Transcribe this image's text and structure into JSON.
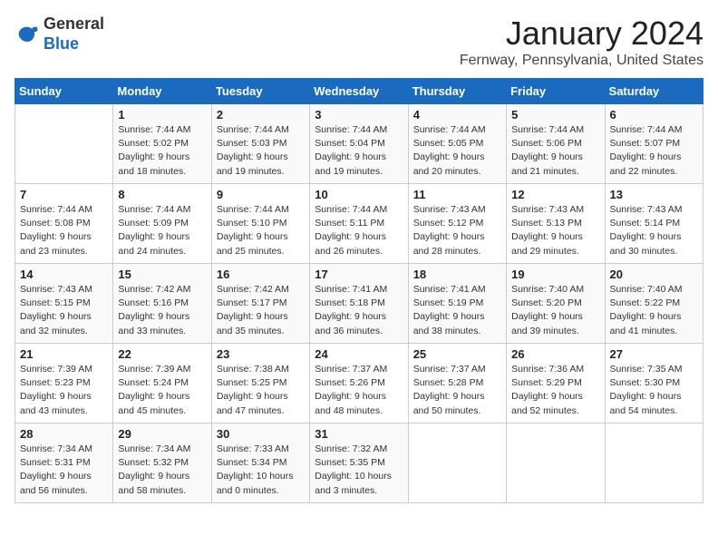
{
  "header": {
    "logo": {
      "general": "General",
      "blue": "Blue"
    },
    "title": "January 2024",
    "subtitle": "Fernway, Pennsylvania, United States"
  },
  "weekdays": [
    "Sunday",
    "Monday",
    "Tuesday",
    "Wednesday",
    "Thursday",
    "Friday",
    "Saturday"
  ],
  "weeks": [
    [
      {
        "day": "",
        "sunrise": "",
        "sunset": "",
        "daylight": ""
      },
      {
        "day": "1",
        "sunrise": "Sunrise: 7:44 AM",
        "sunset": "Sunset: 5:02 PM",
        "daylight": "Daylight: 9 hours and 18 minutes."
      },
      {
        "day": "2",
        "sunrise": "Sunrise: 7:44 AM",
        "sunset": "Sunset: 5:03 PM",
        "daylight": "Daylight: 9 hours and 19 minutes."
      },
      {
        "day": "3",
        "sunrise": "Sunrise: 7:44 AM",
        "sunset": "Sunset: 5:04 PM",
        "daylight": "Daylight: 9 hours and 19 minutes."
      },
      {
        "day": "4",
        "sunrise": "Sunrise: 7:44 AM",
        "sunset": "Sunset: 5:05 PM",
        "daylight": "Daylight: 9 hours and 20 minutes."
      },
      {
        "day": "5",
        "sunrise": "Sunrise: 7:44 AM",
        "sunset": "Sunset: 5:06 PM",
        "daylight": "Daylight: 9 hours and 21 minutes."
      },
      {
        "day": "6",
        "sunrise": "Sunrise: 7:44 AM",
        "sunset": "Sunset: 5:07 PM",
        "daylight": "Daylight: 9 hours and 22 minutes."
      }
    ],
    [
      {
        "day": "7",
        "sunrise": "Sunrise: 7:44 AM",
        "sunset": "Sunset: 5:08 PM",
        "daylight": "Daylight: 9 hours and 23 minutes."
      },
      {
        "day": "8",
        "sunrise": "Sunrise: 7:44 AM",
        "sunset": "Sunset: 5:09 PM",
        "daylight": "Daylight: 9 hours and 24 minutes."
      },
      {
        "day": "9",
        "sunrise": "Sunrise: 7:44 AM",
        "sunset": "Sunset: 5:10 PM",
        "daylight": "Daylight: 9 hours and 25 minutes."
      },
      {
        "day": "10",
        "sunrise": "Sunrise: 7:44 AM",
        "sunset": "Sunset: 5:11 PM",
        "daylight": "Daylight: 9 hours and 26 minutes."
      },
      {
        "day": "11",
        "sunrise": "Sunrise: 7:43 AM",
        "sunset": "Sunset: 5:12 PM",
        "daylight": "Daylight: 9 hours and 28 minutes."
      },
      {
        "day": "12",
        "sunrise": "Sunrise: 7:43 AM",
        "sunset": "Sunset: 5:13 PM",
        "daylight": "Daylight: 9 hours and 29 minutes."
      },
      {
        "day": "13",
        "sunrise": "Sunrise: 7:43 AM",
        "sunset": "Sunset: 5:14 PM",
        "daylight": "Daylight: 9 hours and 30 minutes."
      }
    ],
    [
      {
        "day": "14",
        "sunrise": "Sunrise: 7:43 AM",
        "sunset": "Sunset: 5:15 PM",
        "daylight": "Daylight: 9 hours and 32 minutes."
      },
      {
        "day": "15",
        "sunrise": "Sunrise: 7:42 AM",
        "sunset": "Sunset: 5:16 PM",
        "daylight": "Daylight: 9 hours and 33 minutes."
      },
      {
        "day": "16",
        "sunrise": "Sunrise: 7:42 AM",
        "sunset": "Sunset: 5:17 PM",
        "daylight": "Daylight: 9 hours and 35 minutes."
      },
      {
        "day": "17",
        "sunrise": "Sunrise: 7:41 AM",
        "sunset": "Sunset: 5:18 PM",
        "daylight": "Daylight: 9 hours and 36 minutes."
      },
      {
        "day": "18",
        "sunrise": "Sunrise: 7:41 AM",
        "sunset": "Sunset: 5:19 PM",
        "daylight": "Daylight: 9 hours and 38 minutes."
      },
      {
        "day": "19",
        "sunrise": "Sunrise: 7:40 AM",
        "sunset": "Sunset: 5:20 PM",
        "daylight": "Daylight: 9 hours and 39 minutes."
      },
      {
        "day": "20",
        "sunrise": "Sunrise: 7:40 AM",
        "sunset": "Sunset: 5:22 PM",
        "daylight": "Daylight: 9 hours and 41 minutes."
      }
    ],
    [
      {
        "day": "21",
        "sunrise": "Sunrise: 7:39 AM",
        "sunset": "Sunset: 5:23 PM",
        "daylight": "Daylight: 9 hours and 43 minutes."
      },
      {
        "day": "22",
        "sunrise": "Sunrise: 7:39 AM",
        "sunset": "Sunset: 5:24 PM",
        "daylight": "Daylight: 9 hours and 45 minutes."
      },
      {
        "day": "23",
        "sunrise": "Sunrise: 7:38 AM",
        "sunset": "Sunset: 5:25 PM",
        "daylight": "Daylight: 9 hours and 47 minutes."
      },
      {
        "day": "24",
        "sunrise": "Sunrise: 7:37 AM",
        "sunset": "Sunset: 5:26 PM",
        "daylight": "Daylight: 9 hours and 48 minutes."
      },
      {
        "day": "25",
        "sunrise": "Sunrise: 7:37 AM",
        "sunset": "Sunset: 5:28 PM",
        "daylight": "Daylight: 9 hours and 50 minutes."
      },
      {
        "day": "26",
        "sunrise": "Sunrise: 7:36 AM",
        "sunset": "Sunset: 5:29 PM",
        "daylight": "Daylight: 9 hours and 52 minutes."
      },
      {
        "day": "27",
        "sunrise": "Sunrise: 7:35 AM",
        "sunset": "Sunset: 5:30 PM",
        "daylight": "Daylight: 9 hours and 54 minutes."
      }
    ],
    [
      {
        "day": "28",
        "sunrise": "Sunrise: 7:34 AM",
        "sunset": "Sunset: 5:31 PM",
        "daylight": "Daylight: 9 hours and 56 minutes."
      },
      {
        "day": "29",
        "sunrise": "Sunrise: 7:34 AM",
        "sunset": "Sunset: 5:32 PM",
        "daylight": "Daylight: 9 hours and 58 minutes."
      },
      {
        "day": "30",
        "sunrise": "Sunrise: 7:33 AM",
        "sunset": "Sunset: 5:34 PM",
        "daylight": "Daylight: 10 hours and 0 minutes."
      },
      {
        "day": "31",
        "sunrise": "Sunrise: 7:32 AM",
        "sunset": "Sunset: 5:35 PM",
        "daylight": "Daylight: 10 hours and 3 minutes."
      },
      {
        "day": "",
        "sunrise": "",
        "sunset": "",
        "daylight": ""
      },
      {
        "day": "",
        "sunrise": "",
        "sunset": "",
        "daylight": ""
      },
      {
        "day": "",
        "sunrise": "",
        "sunset": "",
        "daylight": ""
      }
    ]
  ]
}
